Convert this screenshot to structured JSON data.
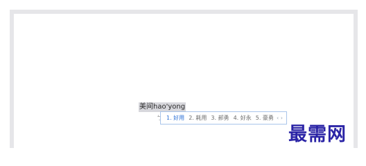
{
  "editor": {
    "composition_text": "美间hao'yong"
  },
  "ime": {
    "logo_glyph": "ㄅ",
    "candidates": [
      {
        "label": "1. 好用"
      },
      {
        "label": "2. 耗用"
      },
      {
        "label": "3. 郝勇"
      },
      {
        "label": "4. 好永"
      },
      {
        "label": "5. 豪勇"
      }
    ],
    "selected_index": 0,
    "pager": "‹ ›"
  },
  "watermark": {
    "text": "最需网"
  },
  "colors": {
    "frame": "#e6e6e9",
    "selected_candidate": "#2a6fd6",
    "watermark": "#2b24a6",
    "ime_border": "#a9c5ea"
  }
}
